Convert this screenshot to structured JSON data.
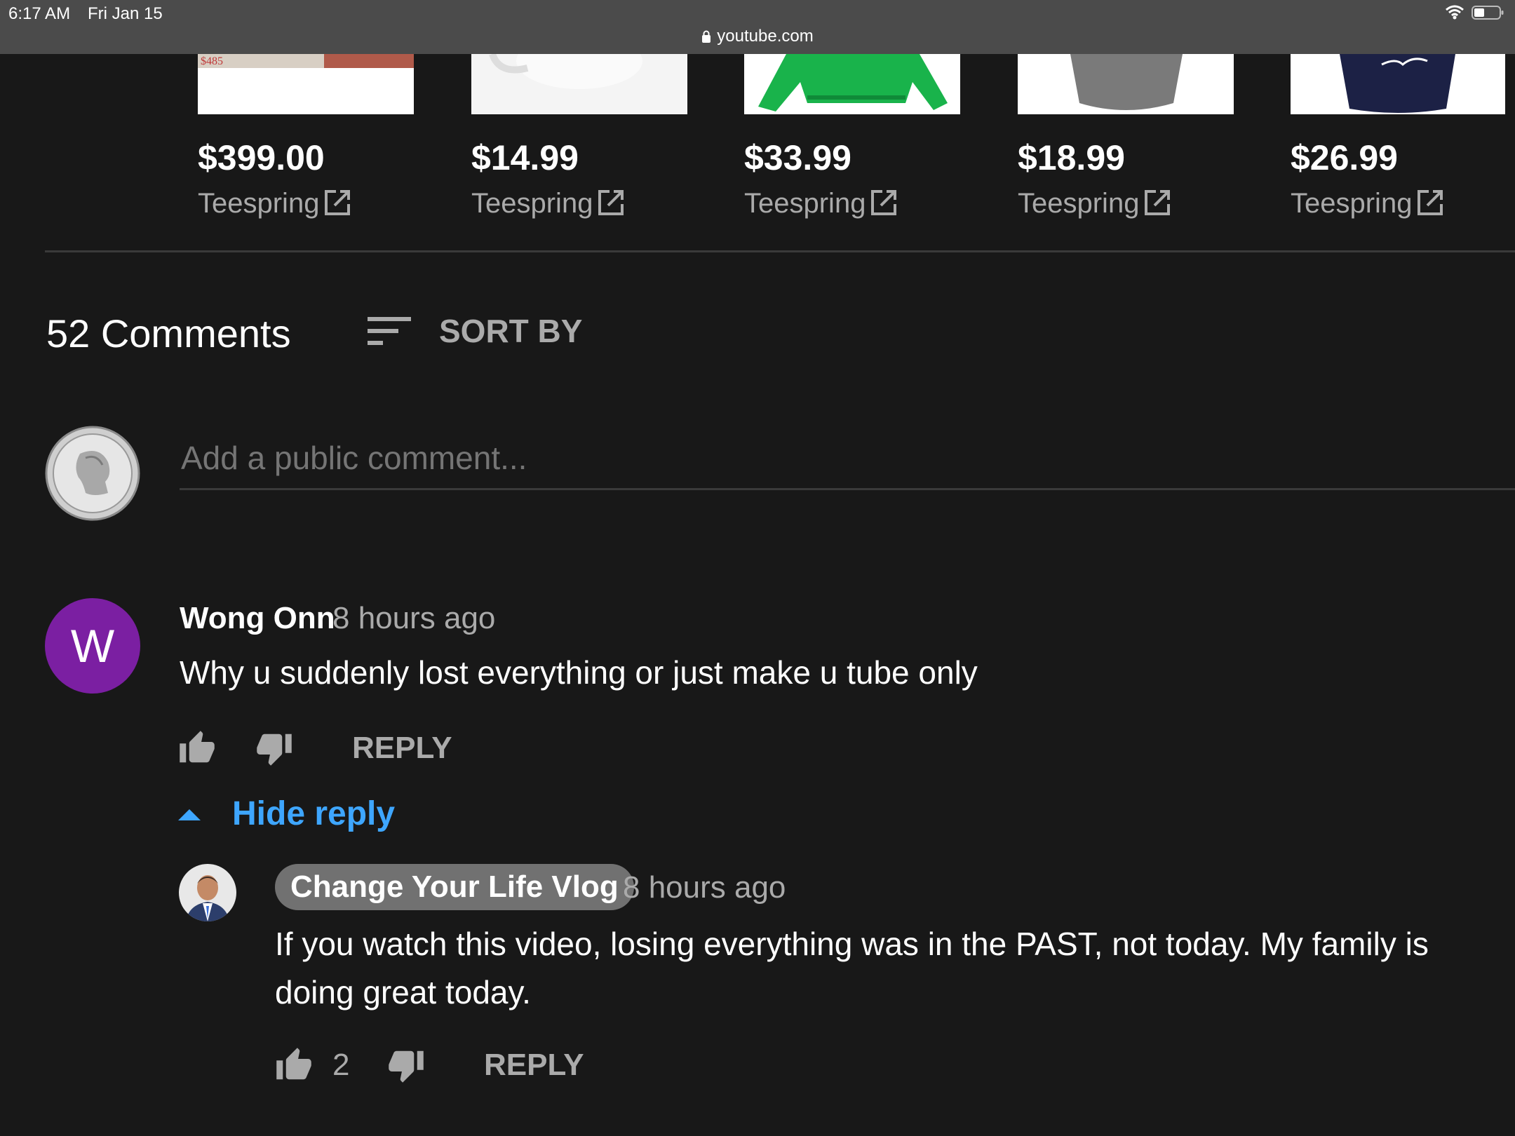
{
  "status_bar": {
    "time": "6:17 AM",
    "date": "Fri Jan 15",
    "url": "youtube.com",
    "icons": [
      "lock-icon",
      "wifi-icon",
      "battery-icon"
    ]
  },
  "products": [
    {
      "price": "$399.00",
      "merchant": "Teespring",
      "thumb_text": "$485"
    },
    {
      "price": "$14.99",
      "merchant": "Teespring"
    },
    {
      "price": "$33.99",
      "merchant": "Teespring"
    },
    {
      "price": "$18.99",
      "merchant": "Teespring"
    },
    {
      "price": "$26.99",
      "merchant": "Teespring"
    }
  ],
  "comments_header": {
    "count_label": "52 Comments",
    "sort_label": "SORT BY"
  },
  "add_comment": {
    "placeholder": "Add a public comment..."
  },
  "comments": [
    {
      "avatar_letter": "W",
      "author": "Wong Onn",
      "time": "8 hours ago",
      "text": "Why u suddenly lost everything or just make u tube only",
      "reply_label": "REPLY",
      "hide_reply_label": "Hide reply",
      "replies": [
        {
          "author": "Change Your Life Vlog",
          "time": "8 hours ago",
          "text": "If you watch this video, losing everything was in the PAST, not today. My family is doing great today.",
          "likes": "2",
          "reply_label": "REPLY"
        }
      ]
    }
  ],
  "colors": {
    "background": "#181818",
    "status_bar": "#4b4b4b",
    "link_blue": "#3ea6ff",
    "avatar_purple": "#7b1fa2",
    "secondary_text": "#aaaaaa",
    "author_badge": "#717171"
  }
}
